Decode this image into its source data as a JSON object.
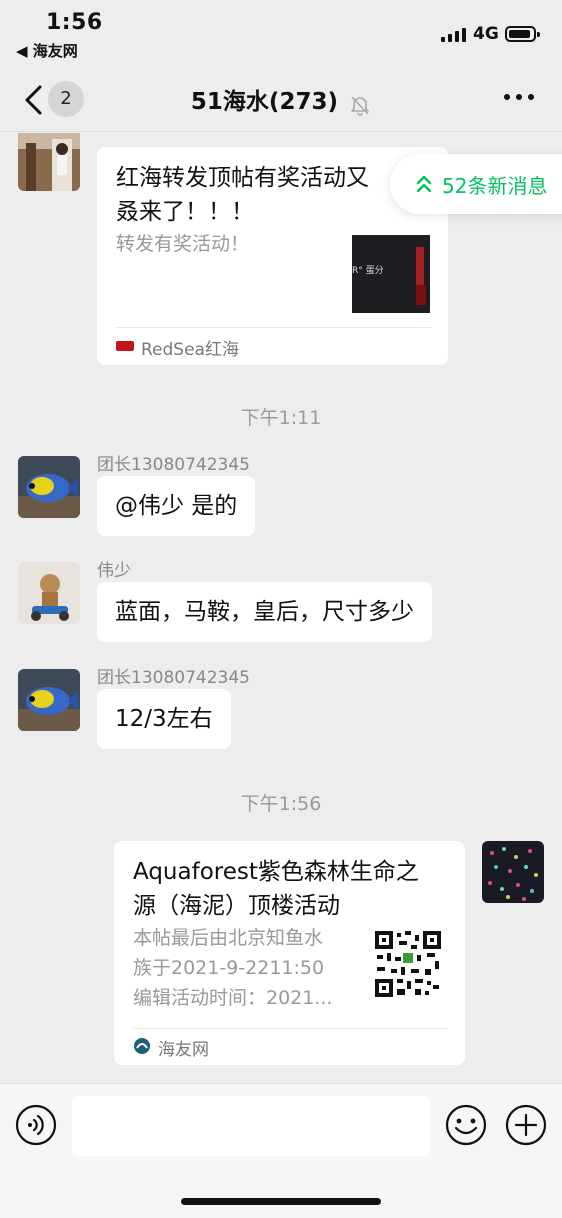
{
  "status_bar": {
    "time": "1:56",
    "back_app": "◀ 海友网",
    "network": "4G"
  },
  "nav": {
    "back_count": "2",
    "title": "51海水(273)"
  },
  "new_messages": {
    "label": "52条新消息"
  },
  "messages": [
    {
      "type": "link_card",
      "title": "红海转发顶帖有奖活动又\n叒来了！！！",
      "desc": "转发有奖活动！",
      "thumb_text": "R° 蛋分",
      "source": "RedSea红海"
    },
    {
      "type": "time",
      "text": "下午1:11"
    },
    {
      "type": "text",
      "sender": "团长13080742345",
      "text": "@伟少 是的"
    },
    {
      "type": "text",
      "sender": "伟少",
      "text": "蓝面，马鞍，皇后，尺寸多少"
    },
    {
      "type": "text",
      "sender": "团长13080742345",
      "text": "12/3左右"
    },
    {
      "type": "time",
      "text": "下午1:56"
    },
    {
      "type": "link_card",
      "title": "Aquaforest紫色森林生命之\n源（海泥）顶楼活动",
      "desc": "本帖最后由北京知鱼水\n族于2021-9-2211:50\n编辑活动时间：2021...",
      "source": "海友网"
    }
  ],
  "input": {
    "value": ""
  },
  "colors": {
    "accent_green": "#07c160",
    "background": "#ededed",
    "bubble": "#ffffff"
  }
}
